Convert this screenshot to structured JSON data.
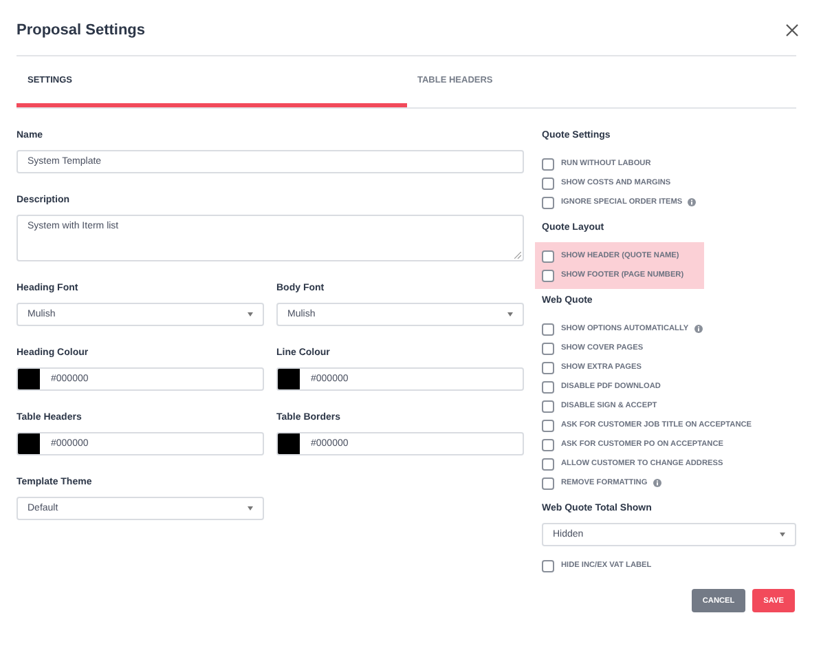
{
  "dialog": {
    "title": "Proposal Settings"
  },
  "tabs": [
    {
      "label": "SETTINGS",
      "selected": true
    },
    {
      "label": "TABLE HEADERS",
      "selected": false
    }
  ],
  "name": {
    "label": "Name",
    "value": "System Template"
  },
  "description": {
    "label": "Description",
    "value": "System with Iterm list"
  },
  "fonts": [
    {
      "label": "Heading Font",
      "value": "Mulish"
    },
    {
      "label": "Body Font",
      "value": "Mulish"
    }
  ],
  "colours": [
    {
      "label": "Heading Colour",
      "value": "#000000",
      "color": "#000000"
    },
    {
      "label": "Line Colour",
      "value": "#000000",
      "color": "#000000"
    },
    {
      "label": "Table Headers",
      "value": "#000000",
      "color": "#000000"
    },
    {
      "label": "Table Borders",
      "value": "#000000",
      "color": "#000000"
    }
  ],
  "template_theme": {
    "label": "Template Theme",
    "value": "Default"
  },
  "groups": [
    {
      "title": "Quote Settings",
      "highlighted": false,
      "items": [
        {
          "label": "RUN WITHOUT LABOUR",
          "checked": false,
          "info": false
        },
        {
          "label": "SHOW COSTS AND MARGINS",
          "checked": false,
          "info": false
        },
        {
          "label": "IGNORE SPECIAL ORDER ITEMS",
          "checked": false,
          "info": true
        }
      ]
    },
    {
      "title": "Quote Layout",
      "highlighted": true,
      "items": [
        {
          "label": "SHOW HEADER (QUOTE NAME)",
          "checked": false,
          "info": false
        },
        {
          "label": "SHOW FOOTER (PAGE NUMBER)",
          "checked": false,
          "info": false
        }
      ]
    },
    {
      "title": "Web Quote",
      "highlighted": false,
      "items": [
        {
          "label": "SHOW OPTIONS AUTOMATICALLY",
          "checked": false,
          "info": true
        },
        {
          "label": "SHOW COVER PAGES",
          "checked": false,
          "info": false
        },
        {
          "label": "SHOW EXTRA PAGES",
          "checked": false,
          "info": false
        },
        {
          "label": "DISABLE PDF DOWNLOAD",
          "checked": false,
          "info": false
        },
        {
          "label": "DISABLE SIGN & ACCEPT",
          "checked": false,
          "info": false
        },
        {
          "label": "ASK FOR CUSTOMER JOB TITLE ON ACCEPTANCE",
          "checked": false,
          "info": false
        },
        {
          "label": "ASK FOR CUSTOMER PO ON ACCEPTANCE",
          "checked": false,
          "info": false
        },
        {
          "label": "ALLOW CUSTOMER TO CHANGE ADDRESS",
          "checked": false,
          "info": false
        },
        {
          "label": "REMOVE FORMATTING",
          "checked": false,
          "info": true
        }
      ]
    }
  ],
  "total_shown": {
    "label": "Web Quote Total Shown",
    "value": "Hidden"
  },
  "vat_label": {
    "label": "HIDE INC/EX VAT LABEL",
    "checked": false
  },
  "buttons": [
    {
      "label": "CANCEL",
      "kind": "secondary"
    },
    {
      "label": "SAVE",
      "kind": "primary"
    }
  ]
}
